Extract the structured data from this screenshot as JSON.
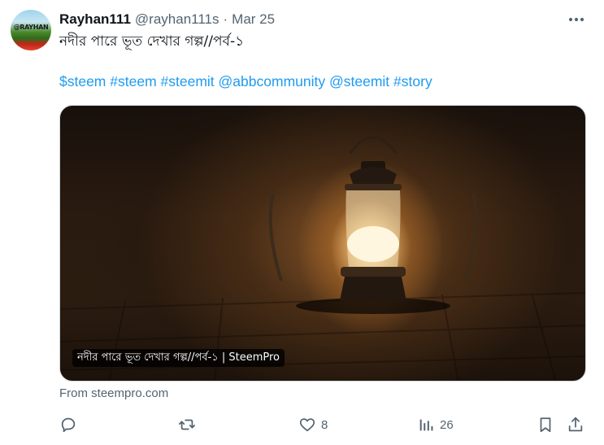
{
  "author": {
    "display_name": "Rayhan111",
    "handle": "@rayhan111s",
    "separator": "·",
    "date": "Mar 25",
    "avatar_text": "@RAYHAN"
  },
  "tweet": {
    "text": "নদীর পারে ভূত দেখার গল্প//পর্ব-১",
    "hashtags": [
      "$steem",
      "#steem",
      "#steemit",
      "@abbcommunity",
      "@steemit",
      "#story"
    ]
  },
  "card": {
    "caption": "নদীর পারে ভূত দেখার গল্প//পর্ব-১ | SteemPro",
    "source": "From steempro.com"
  },
  "actions": {
    "reply_icon": "reply-icon",
    "retweet_icon": "retweet-icon",
    "like_icon": "heart-icon",
    "like_count": "8",
    "views_icon": "views-icon",
    "views_count": "26",
    "bookmark_icon": "bookmark-icon",
    "share_icon": "share-icon"
  },
  "colors": {
    "link": "#1d9bf0",
    "muted": "#536471",
    "text": "#0f1419"
  }
}
